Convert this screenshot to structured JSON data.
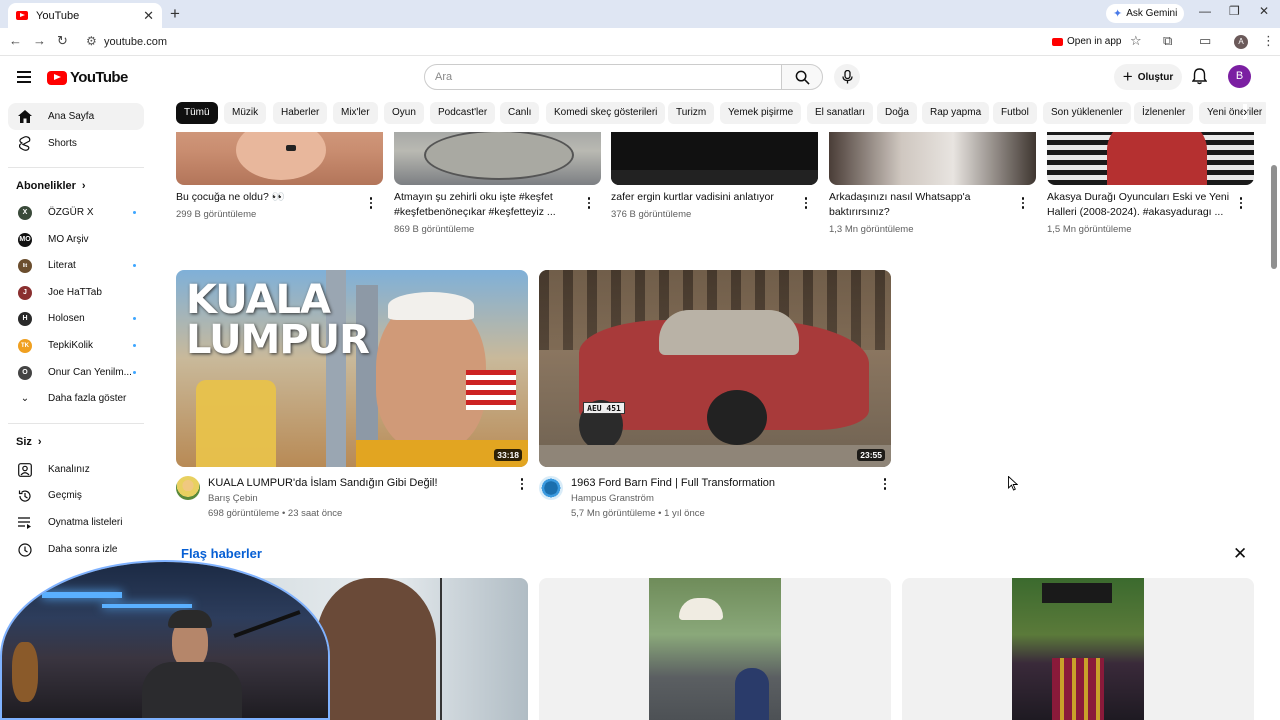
{
  "browser": {
    "tab_title": "YouTube",
    "url": "youtube.com",
    "ask_gemini": "Ask Gemini",
    "open_in_app": "Open in app",
    "profile_initial": "A"
  },
  "header": {
    "logo_text": "YouTube",
    "search_placeholder": "Ara",
    "create_label": "Oluştur",
    "avatar_initial": "B"
  },
  "sidebar": {
    "home": "Ana Sayfa",
    "shorts": "Shorts",
    "subscriptions_title": "Abonelikler",
    "channels": [
      {
        "name": "ÖZGÜR X",
        "color": "#3a4a3a",
        "initial": "X",
        "new": true
      },
      {
        "name": "MO Arşiv",
        "color": "#111111",
        "initial": "MO",
        "new": false
      },
      {
        "name": "Literat",
        "color": "#6b4e2e",
        "initial": "lit",
        "new": true
      },
      {
        "name": "Joe HaTTab",
        "color": "#8a2f2f",
        "initial": "J",
        "new": false
      },
      {
        "name": "Holosen",
        "color": "#2a2a2a",
        "initial": "H",
        "new": true
      },
      {
        "name": "TepkiKolik",
        "color": "#f0a020",
        "initial": "TK",
        "new": true
      },
      {
        "name": "Onur Can Yenilm...",
        "color": "#444444",
        "initial": "O",
        "new": true
      }
    ],
    "show_more": "Daha fazla göster",
    "you_title": "Siz",
    "you_items": [
      "Kanalınız",
      "Geçmiş",
      "Oynatma listeleri",
      "Daha sonra izle"
    ]
  },
  "chips": [
    "Tümü",
    "Müzik",
    "Haberler",
    "Mix'ler",
    "Oyun",
    "Podcast'ler",
    "Canlı",
    "Komedi skeç gösterileri",
    "Turizm",
    "Yemek pişirme",
    "El sanatları",
    "Doğa",
    "Rap yapma",
    "Futbol",
    "Son yüklenenler",
    "İzlenenler",
    "Yeni öneriler"
  ],
  "top_row": [
    {
      "title1": "Bu çocuğa ne oldu? 👀",
      "title2": "",
      "views": "299 B görüntüleme"
    },
    {
      "title1": "Atmayın şu zehirli oku işte #keşfet",
      "title2": "#keşfetbenöneçıkar #keşfetteyiz ...",
      "views": "869 B görüntüleme"
    },
    {
      "title1": "zafer ergin kurtlar vadisini anlatıyor",
      "title2": "",
      "views": "376 B görüntüleme"
    },
    {
      "title1": "Arkadaşınızı nasıl Whatsapp'a",
      "title2": "baktırırsınız?",
      "views": "1,3 Mn görüntüleme"
    },
    {
      "title1": "Akasya Durağı Oyuncuları Eski ve Yeni",
      "title2": "Halleri (2008-2024). #akasyaduragı ...",
      "views": "1,5 Mn görüntüleme"
    }
  ],
  "videos": [
    {
      "title": "KUALA LUMPUR'da İslam Sandığın Gibi Değil!",
      "channel": "Barış Çebin",
      "meta": "698 görüntüleme • 23 saat önce",
      "duration": "33:18",
      "thumb_text_1": "KUALA",
      "thumb_text_2": "LUMPUR"
    },
    {
      "title": "1963 Ford Barn Find | Full Transformation",
      "channel": "Hampus Granström",
      "meta": "5,7 Mn görüntüleme • 1 yıl önce",
      "duration": "23:55",
      "plate": "AEU 451"
    }
  ],
  "breaking_news": {
    "title": "Flaş haberler"
  }
}
